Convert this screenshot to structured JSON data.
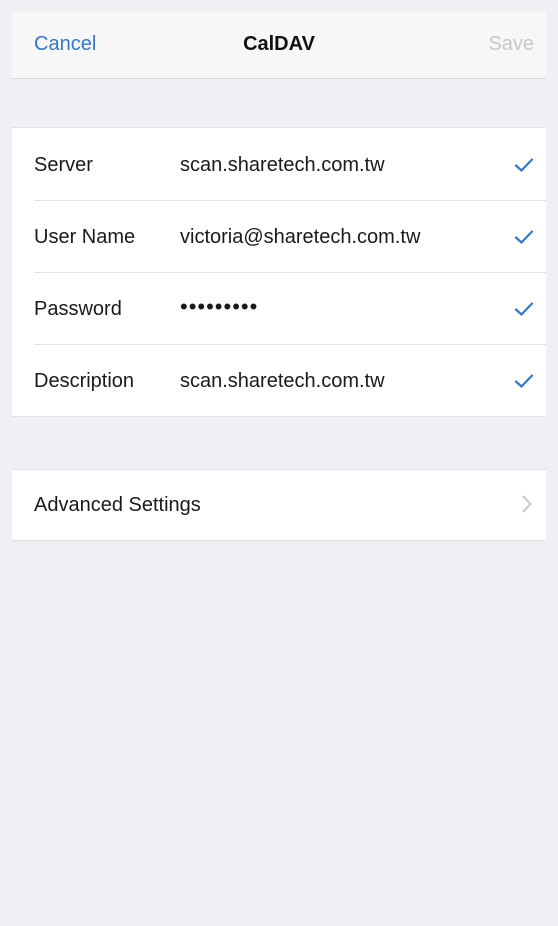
{
  "nav": {
    "cancel_label": "Cancel",
    "title": "CalDAV",
    "save_label": "Save"
  },
  "account": {
    "rows": [
      {
        "label": "Server",
        "value": "scan.sharetech.com.tw",
        "icon": "checkmark-icon"
      },
      {
        "label": "User Name",
        "value": "victoria@sharetech.com.tw",
        "icon": "checkmark-icon"
      },
      {
        "label": "Password",
        "value": "•••••••••",
        "icon": "checkmark-icon"
      },
      {
        "label": "Description",
        "value": "scan.sharetech.com.tw",
        "icon": "checkmark-icon"
      }
    ]
  },
  "advanced": {
    "label": "Advanced Settings",
    "icon": "chevron-right-icon"
  },
  "colors": {
    "accent": "#3478c6",
    "disabled": "#c7c7cc",
    "background": "#efeff4"
  }
}
